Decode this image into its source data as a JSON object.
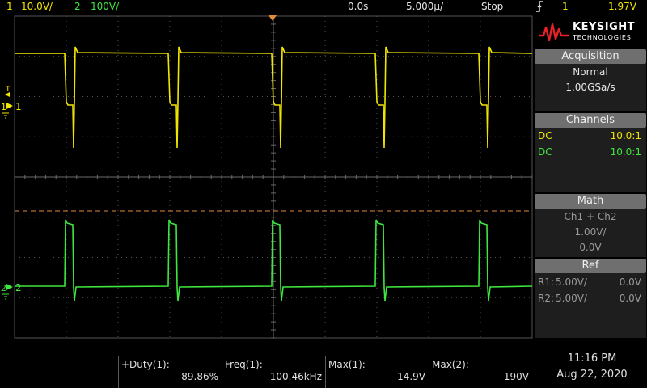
{
  "topbar": {
    "ch1_num": "1",
    "ch1_scale": "10.0V/",
    "ch2_num": "2",
    "ch2_scale": "100V/",
    "time_delay": "0.0s",
    "time_scale": "5.000µ/",
    "run_state": "Stop",
    "trigger_icon": "trigger-edge-icon",
    "trigger_source": "1",
    "trigger_level": "1.97V"
  },
  "screen": {
    "ch1_marker": "1",
    "ch2_marker": "2",
    "trigger_marker": "T",
    "colors": {
      "ch1": "#f2e600",
      "ch2": "#3ee63e",
      "grid": "#555555",
      "trigger": "#e08a3a"
    }
  },
  "panel": {
    "brand": "KEYSIGHT",
    "brand_sub": "TECHNOLOGIES",
    "acquisition": {
      "title": "Acquisition",
      "mode": "Normal",
      "rate": "1.00GSa/s"
    },
    "channels": {
      "title": "Channels",
      "rows": [
        {
          "coupling": "DC",
          "probe": "10.0:1"
        },
        {
          "coupling": "DC",
          "probe": "10.0:1"
        }
      ]
    },
    "math": {
      "title": "Math",
      "function": "Ch1 + Ch2",
      "scale": "1.00V/",
      "offset": "0.0V"
    },
    "ref": {
      "title": "Ref",
      "rows": [
        {
          "name": "R1:",
          "scale": "5.00V/",
          "offset": "0.0V"
        },
        {
          "name": "R2:",
          "scale": "5.00V/",
          "offset": "0.0V"
        }
      ]
    }
  },
  "measurements": [
    {
      "label": "+Duty(1):",
      "value": "89.86%"
    },
    {
      "label": "Freq(1):",
      "value": "100.46kHz"
    },
    {
      "label": "Max(1):",
      "value": "14.9V"
    },
    {
      "label": "Max(2):",
      "value": "190V"
    }
  ],
  "clock": {
    "time": "11:16 PM",
    "date": "Aug 22, 2020"
  }
}
